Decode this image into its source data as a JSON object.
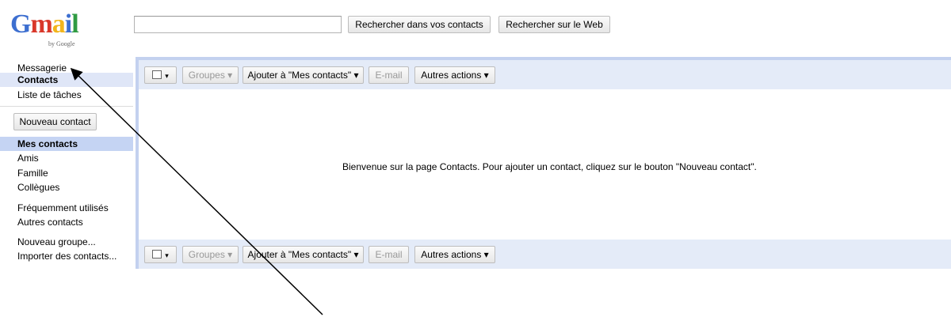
{
  "header": {
    "logo_text": "Gmail",
    "logo_subtext": "by Google",
    "search_placeholder": "",
    "search_contacts_label": "Rechercher dans vos contacts",
    "search_web_label": "Rechercher sur le Web"
  },
  "sidebar": {
    "nav": [
      "Messagerie",
      "Contacts",
      "Liste de tâches"
    ],
    "new_contact_label": "Nouveau contact",
    "groups": [
      "Mes contacts",
      "Amis",
      "Famille",
      "Collègues"
    ],
    "extra": [
      "Fréquemment utilisés",
      "Autres contacts"
    ],
    "actions": [
      "Nouveau groupe...",
      "Importer des contacts..."
    ]
  },
  "toolbar": {
    "checkbox_caret": "▾",
    "groups_label": "Groupes ▾",
    "add_to_my_contacts_label": "Ajouter à \"Mes contacts\" ▾",
    "email_label": "E-mail",
    "more_actions_label": "Autres actions ▾"
  },
  "main": {
    "welcome_text": "Bienvenue sur la page Contacts. Pour ajouter un contact, cliquez sur le bouton \"Nouveau contact\"."
  },
  "colors": {
    "panel_border": "#c3d1ef",
    "toolbar_bg": "#e4ebf8",
    "selected_bg": "#c5d4f3",
    "nav_selected_bg": "#dfe6f7"
  }
}
